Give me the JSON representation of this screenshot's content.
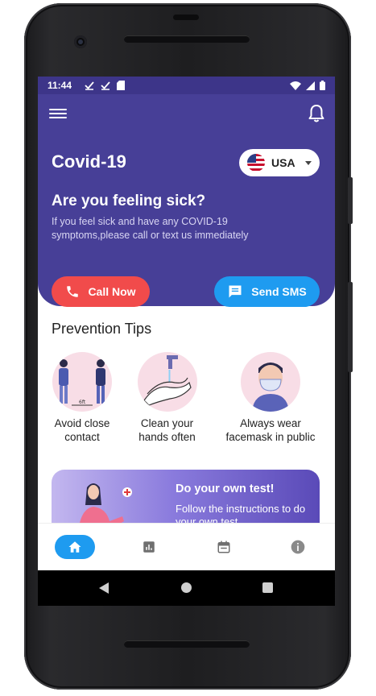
{
  "status_bar": {
    "time": "11:44",
    "notification_icons": [
      "check-icon",
      "check-icon",
      "sd-card-icon"
    ],
    "system_icons": [
      "wifi-icon",
      "signal-icon",
      "battery-icon"
    ]
  },
  "header": {
    "title": "Covid-19",
    "country": {
      "label": "USA",
      "flag": "us-flag"
    }
  },
  "alert": {
    "question": "Are you feeling sick?",
    "message": "If you feel sick and have any COVID-19 symptoms,please call or text us immediately",
    "call_label": "Call Now",
    "sms_label": "Send SMS"
  },
  "prevention": {
    "title": "Prevention Tips",
    "tips": [
      {
        "label": "Avoid close contact",
        "icon": "distance-icon"
      },
      {
        "label": "Clean your hands often",
        "icon": "handwash-icon"
      },
      {
        "label": "Always wear facemask in public",
        "icon": "facemask-icon"
      }
    ]
  },
  "banner": {
    "title": "Do your own test!",
    "subtitle": "Follow the instructions to do your own test."
  },
  "bottom_nav": [
    {
      "name": "home",
      "icon": "home-icon",
      "active": true
    },
    {
      "name": "stats",
      "icon": "chart-icon",
      "active": false
    },
    {
      "name": "calendar",
      "icon": "calendar-icon",
      "active": false
    },
    {
      "name": "info",
      "icon": "info-icon",
      "active": false
    }
  ],
  "colors": {
    "primary": "#473f97",
    "call": "#f14b4b",
    "sms": "#1e9bf0",
    "tip_circle": "#f8dde6"
  }
}
